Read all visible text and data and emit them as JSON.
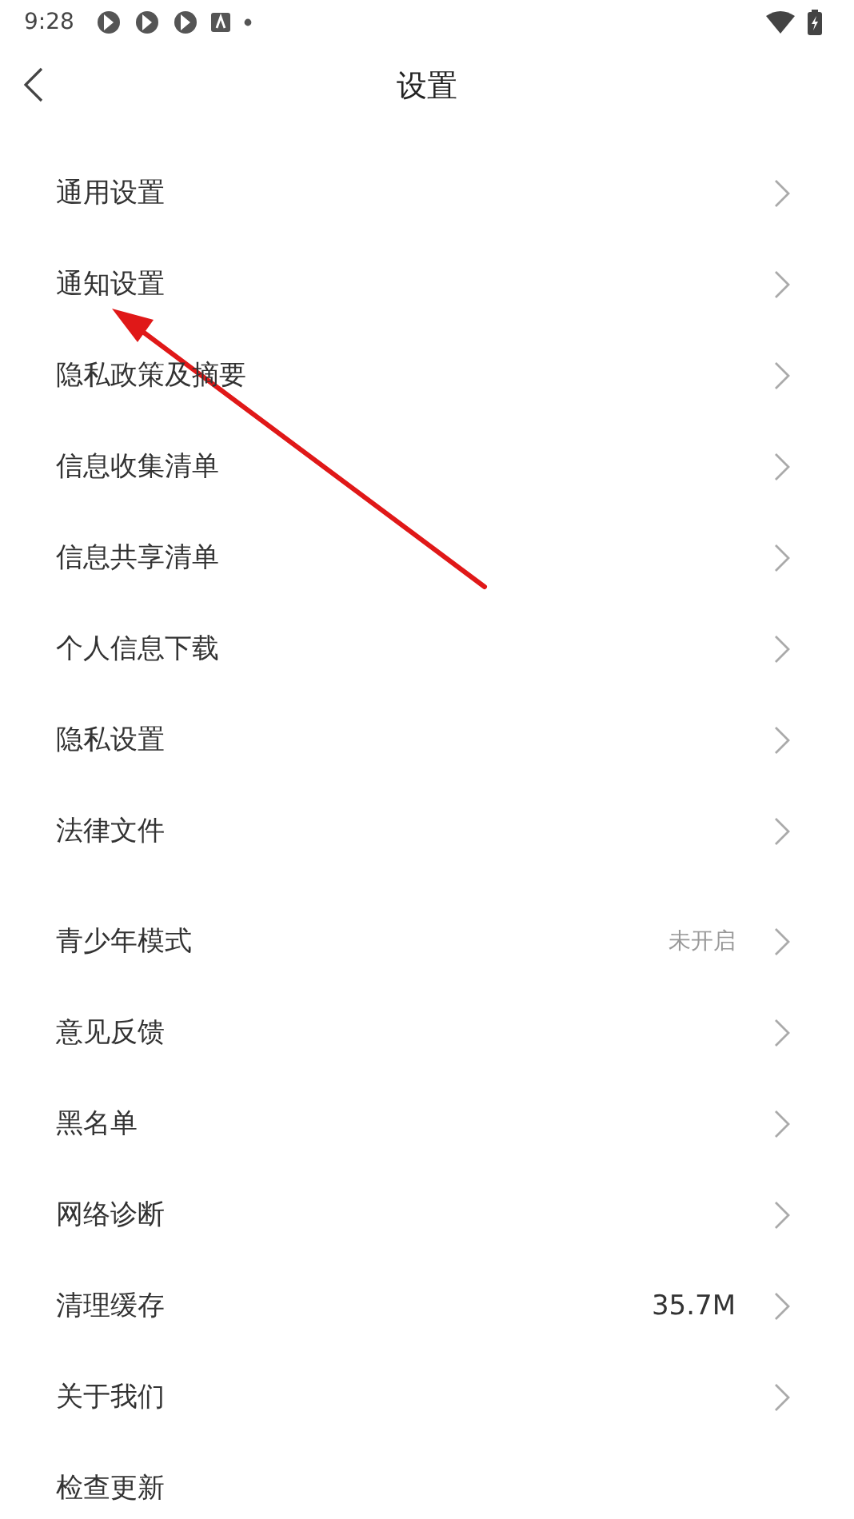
{
  "status_bar": {
    "time": "9:28"
  },
  "header": {
    "title": "设置"
  },
  "groups": [
    {
      "items": [
        {
          "label": "通用设置"
        },
        {
          "label": "通知设置"
        },
        {
          "label": "隐私政策及摘要"
        },
        {
          "label": "信息收集清单"
        },
        {
          "label": "信息共享清单"
        },
        {
          "label": "个人信息下载"
        },
        {
          "label": "隐私设置"
        },
        {
          "label": "法律文件"
        }
      ]
    },
    {
      "items": [
        {
          "label": "青少年模式",
          "value": "未开启",
          "kind": "status"
        },
        {
          "label": "意见反馈"
        },
        {
          "label": "黑名单"
        },
        {
          "label": "网络诊断"
        },
        {
          "label": "清理缓存",
          "value": "35.7M",
          "kind": "size"
        },
        {
          "label": "关于我们"
        },
        {
          "label": "检查更新",
          "chevron": false
        }
      ]
    }
  ]
}
